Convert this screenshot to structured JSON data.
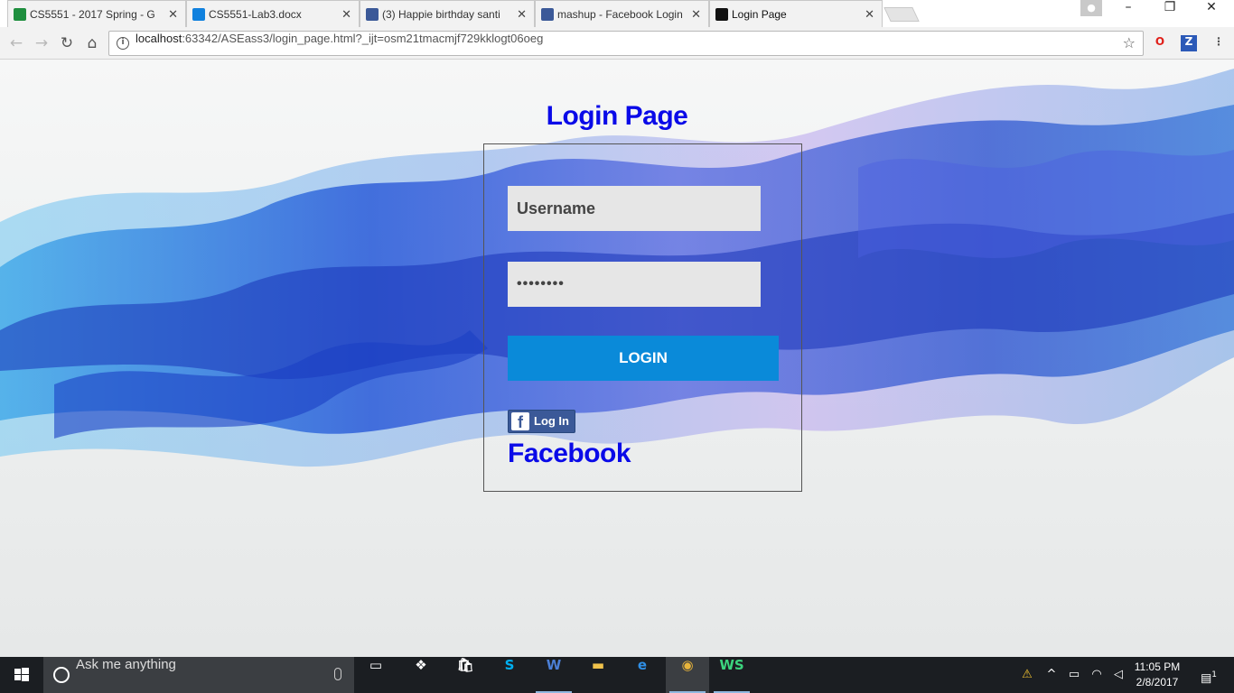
{
  "browser": {
    "tabs": [
      {
        "title": "CS5551 - 2017 Spring - G",
        "icon": "sheets-icon",
        "active": false
      },
      {
        "title": "CS5551-Lab3.docx",
        "icon": "dropbox-icon",
        "active": false
      },
      {
        "title": "(3) Happie birthday santi",
        "icon": "facebook-icon",
        "active": false
      },
      {
        "title": "mashup - Facebook Login",
        "icon": "facebook-icon",
        "active": false
      },
      {
        "title": "Login Page",
        "icon": "webstorm-icon",
        "active": true
      }
    ],
    "url_host": "localhost",
    "url_rest": ":63342/ASEass3/login_page.html?_ijt=osm21tmacmjf729kklogt06oeg",
    "window_controls": {
      "minimize": "–",
      "restore": "❐",
      "close": "✕"
    }
  },
  "page": {
    "title": "Login Page",
    "username_placeholder": "Username",
    "password_value": "••••••••",
    "login_label": "LOGIN",
    "fb_button_label": "Log In",
    "fb_text": "Facebook"
  },
  "taskbar": {
    "search_placeholder": "Ask me anything",
    "time": "11:05 PM",
    "date": "2/8/2017",
    "notification_count": "1"
  },
  "colors": {
    "title_blue": "#0a0ae8",
    "login_button": "#0a8ad9",
    "facebook_blue": "#3b5998"
  }
}
